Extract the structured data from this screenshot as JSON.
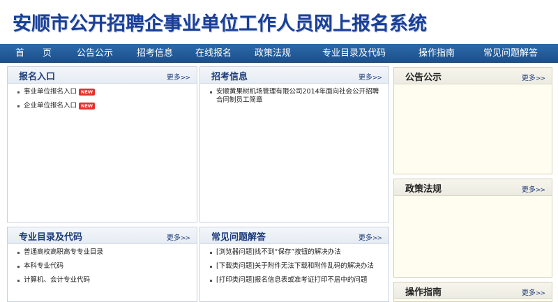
{
  "site": {
    "title": "安顺市公开招聘企事业单位工作人员网上报名系统"
  },
  "nav": [
    {
      "label": "首　　页"
    },
    {
      "label": "公告公示"
    },
    {
      "label": "招考信息"
    },
    {
      "label": "在线报名"
    },
    {
      "label": "政策法规"
    },
    {
      "label": "专业目录及代码"
    },
    {
      "label": "操作指南"
    },
    {
      "label": "常见问题解答"
    }
  ],
  "more_label": "更多",
  "more_arrows": ">>",
  "panels": {
    "register": {
      "title": "报名入口",
      "items": [
        {
          "text": "事业单位报名入口",
          "badge": "NEW"
        },
        {
          "text": "企业单位报名入口",
          "badge": "NEW"
        }
      ]
    },
    "recruit": {
      "title": "招考信息",
      "items": [
        {
          "text": "安顺黄果树机场管理有限公司2014年面向社会公开招聘合同制员工简章"
        }
      ]
    },
    "catalog": {
      "title": "专业目录及代码",
      "items": [
        {
          "text": "普通高校高职高专专业目录"
        },
        {
          "text": "本科专业代码"
        },
        {
          "text": "计算机、会计专业代码"
        }
      ]
    },
    "faq": {
      "title": "常见问题解答",
      "items": [
        {
          "text": "[浏览器问题]找不到“保存”按钮的解决办法"
        },
        {
          "text": "[下载类问题]关于附件无法下载和附件乱码的解决办法"
        },
        {
          "text": "[打印类问题]报名信息表或准考证打印不居中的问题"
        }
      ]
    },
    "notice": {
      "title": "公告公示"
    },
    "policy": {
      "title": "政策法规"
    },
    "guide": {
      "title": "操作指南"
    }
  },
  "colors": {
    "nav_bg": "#1f5592",
    "title_blue": "#1a3f96",
    "badge_red": "#e4322b"
  }
}
